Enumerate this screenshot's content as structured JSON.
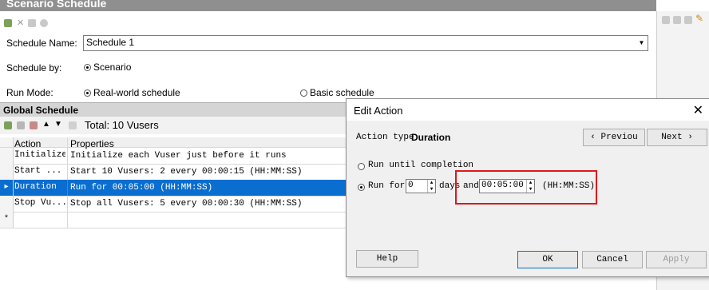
{
  "window": {
    "title": "Scenario Schedule"
  },
  "schedule": {
    "name_label": "Schedule Name:",
    "name_value": "Schedule 1",
    "schedule_by_label": "Schedule by:",
    "schedule_by_option": "Scenario",
    "run_mode_label": "Run Mode:",
    "run_mode_options": [
      "Real-world schedule",
      "Basic schedule"
    ]
  },
  "global_schedule": {
    "title": "Global Schedule",
    "total": "Total: 10 Vusers",
    "columns": [
      "Action",
      "Properties"
    ],
    "rows": [
      {
        "action": "Initialize",
        "properties": "Initialize each Vuser just before it runs"
      },
      {
        "action": "Start  ...",
        "properties": "Start 10 Vusers: 2 every 00:00:15 (HH:MM:SS)"
      },
      {
        "action": "Duration",
        "properties": "Run for 00:05:00 (HH:MM:SS)"
      },
      {
        "action": "Stop Vu...",
        "properties": "Stop all Vusers: 5 every 00:00:30 (HH:MM:SS)"
      }
    ],
    "new_row_marker": "*"
  },
  "dialog": {
    "title": "Edit Action",
    "close": "✕",
    "action_type_label": "Action type",
    "action_type_value": "Duration",
    "previous": "‹  Previou",
    "next": "Next  ›",
    "opt_until": "Run until completion",
    "opt_runfor": "Run for",
    "days_value": "0",
    "days_label": "days",
    "and_label": "and",
    "time_value": "00:05:00",
    "format_label": "(HH:MM:SS)",
    "help": "Help",
    "ok": "OK",
    "cancel": "Cancel",
    "apply": "Apply"
  },
  "colors": {
    "selection": "#0a6ed1",
    "highlight": "#e0161b"
  }
}
